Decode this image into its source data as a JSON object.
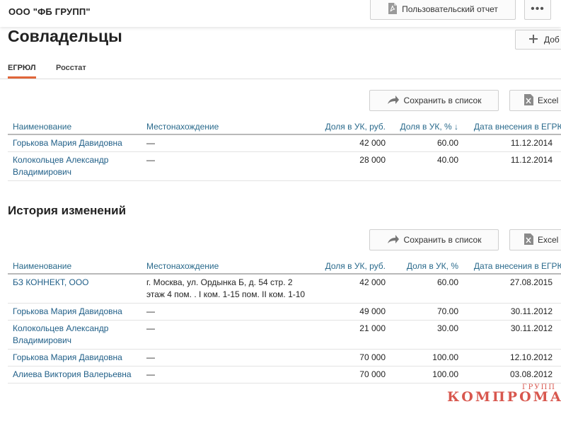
{
  "header": {
    "company": "ООО \"ФБ ГРУПП\"",
    "report_label": "Пользовательский отчет",
    "more_label": "•••"
  },
  "coowners": {
    "title": "Совладельцы",
    "add_label": "Доб",
    "tabs": [
      {
        "label": "ЕГРЮЛ",
        "active": true
      },
      {
        "label": "Росстат",
        "active": false
      }
    ],
    "save_label": "Сохранить в список",
    "excel_label": "Excel",
    "columns": [
      "Наименование",
      "Местонахождение",
      "Доля в УК, руб.",
      "Доля в УК, % ↓",
      "Дата внесения в ЕГРЮЛ"
    ],
    "rows": [
      {
        "name": "Горькова Мария Давидовна",
        "location": "—",
        "amount": "42 000",
        "percent": "60.00",
        "date": "11.12.2014"
      },
      {
        "name": "Колокольцев Александр Владимирович",
        "location": "—",
        "amount": "28 000",
        "percent": "40.00",
        "date": "11.12.2014"
      }
    ]
  },
  "history": {
    "title": "История изменений",
    "save_label": "Сохранить в список",
    "excel_label": "Excel",
    "columns": [
      "Наименование",
      "Местонахождение",
      "Доля в УК, руб.",
      "Доля в УК, %",
      "Дата внесения в ЕГРЮЛ"
    ],
    "rows": [
      {
        "name": "БЗ КОННЕКТ, ООО",
        "location": "г. Москва, ул. Ордынка Б, д. 54 стр. 2 этаж 4 пом. . I ком. 1-15 пом. II ком. 1-10",
        "amount": "42 000",
        "percent": "60.00",
        "date": "27.08.2015"
      },
      {
        "name": "Горькова Мария Давидовна",
        "location": "—",
        "amount": "49 000",
        "percent": "70.00",
        "date": "30.11.2012"
      },
      {
        "name": "Колокольцев Александр Владимирович",
        "location": "—",
        "amount": "21 000",
        "percent": "30.00",
        "date": "30.11.2012"
      },
      {
        "name": "Горькова Мария Давидовна",
        "location": "—",
        "amount": "70 000",
        "percent": "100.00",
        "date": "12.10.2012"
      },
      {
        "name": "Алиева Виктория Валерьевна",
        "location": "—",
        "amount": "70 000",
        "percent": "100.00",
        "date": "03.08.2012"
      }
    ]
  },
  "watermark": {
    "main": "КОМПРОМАТ",
    "small": "ГРУПП"
  },
  "colors": {
    "link": "#1f5e87",
    "header": "#2a6a8c",
    "accent": "#e0663a",
    "watermark": "#d23a30"
  },
  "icons": {
    "report": "pdf-file-icon",
    "share": "share-arrow-icon",
    "excel": "excel-file-icon",
    "add": "plus-icon"
  }
}
